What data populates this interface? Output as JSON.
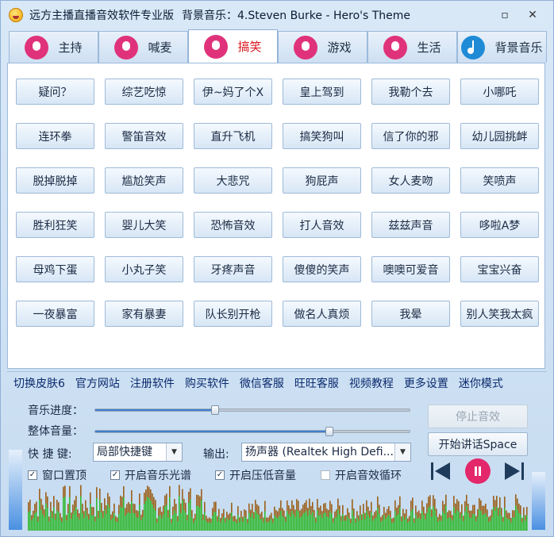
{
  "window": {
    "title": "远方主播直播音效软件专业版",
    "bgm_label": "背景音乐：4.Steven Burke - Hero's Theme",
    "minimize": "▫",
    "close": "✕"
  },
  "tabs": [
    {
      "label": "主持",
      "icon": "host-icon",
      "active": false
    },
    {
      "label": "喊麦",
      "icon": "microphone-icon",
      "active": false
    },
    {
      "label": "搞笑",
      "icon": "laugh-icon",
      "active": true
    },
    {
      "label": "游戏",
      "icon": "gamepad-icon",
      "active": false
    },
    {
      "label": "生活",
      "icon": "coffee-cup-icon",
      "active": false
    },
    {
      "label": "背景音乐",
      "icon": "music-note-icon",
      "active": false
    }
  ],
  "sound_buttons": [
    [
      "疑问？",
      "综艺吃惊",
      "伊~妈了个X",
      "皇上驾到",
      "我勒个去",
      "小哪吒"
    ],
    [
      "连环拳",
      "警笛音效",
      "直升飞机",
      "搞笑狗叫",
      "信了你的邪",
      "幼儿园挑衅"
    ],
    [
      "脱掉脱掉",
      "尴尬笑声",
      "大悲咒",
      "狗屁声",
      "女人麦吻",
      "笑喷声"
    ],
    [
      "胜利狂笑",
      "婴儿大笑",
      "恐怖音效",
      "打人音效",
      "兹兹声音",
      "哆啦A梦"
    ],
    [
      "母鸡下蛋",
      "小丸子笑",
      "牙疼声音",
      "傻傻的笑声",
      "噢噢可爱音",
      "宝宝兴奋"
    ],
    [
      "一夜暴富",
      "家有暴妻",
      "队长别开枪",
      "做名人真烦",
      "我晕",
      "别人笑我太疯"
    ]
  ],
  "links": [
    "切换皮肤6",
    "官方网站",
    "注册软件",
    "购买软件",
    "微信客服",
    "旺旺客服",
    "视频教程",
    "更多设置",
    "迷你模式"
  ],
  "controls": {
    "music_progress_label": "音乐进度：",
    "music_progress_value": 0.38,
    "volume_label": "整体音量：",
    "volume_value": 0.74,
    "hotkey_label": "快 捷 键:",
    "hotkey_value": "局部快捷键",
    "output_label": "输出:",
    "output_value": "扬声器 (Realtek High Defi...",
    "stop_button": "停止音效",
    "talk_button": "开始讲话Space"
  },
  "checkboxes": [
    {
      "label": "窗口置顶",
      "checked": true
    },
    {
      "label": "开启音乐光谱",
      "checked": true
    },
    {
      "label": "开启压低音量",
      "checked": true
    },
    {
      "label": "开启音效循环",
      "checked": false
    }
  ],
  "player": {
    "prev_icon": "previous-track-icon",
    "pause_icon": "pause-icon",
    "next_icon": "next-track-icon",
    "accent": "#e3276a"
  },
  "visualizer": {
    "left_level": 0.9,
    "right_level": 0.65,
    "colors": {
      "low": "#2fb82f",
      "high": "#d03a1a"
    }
  }
}
